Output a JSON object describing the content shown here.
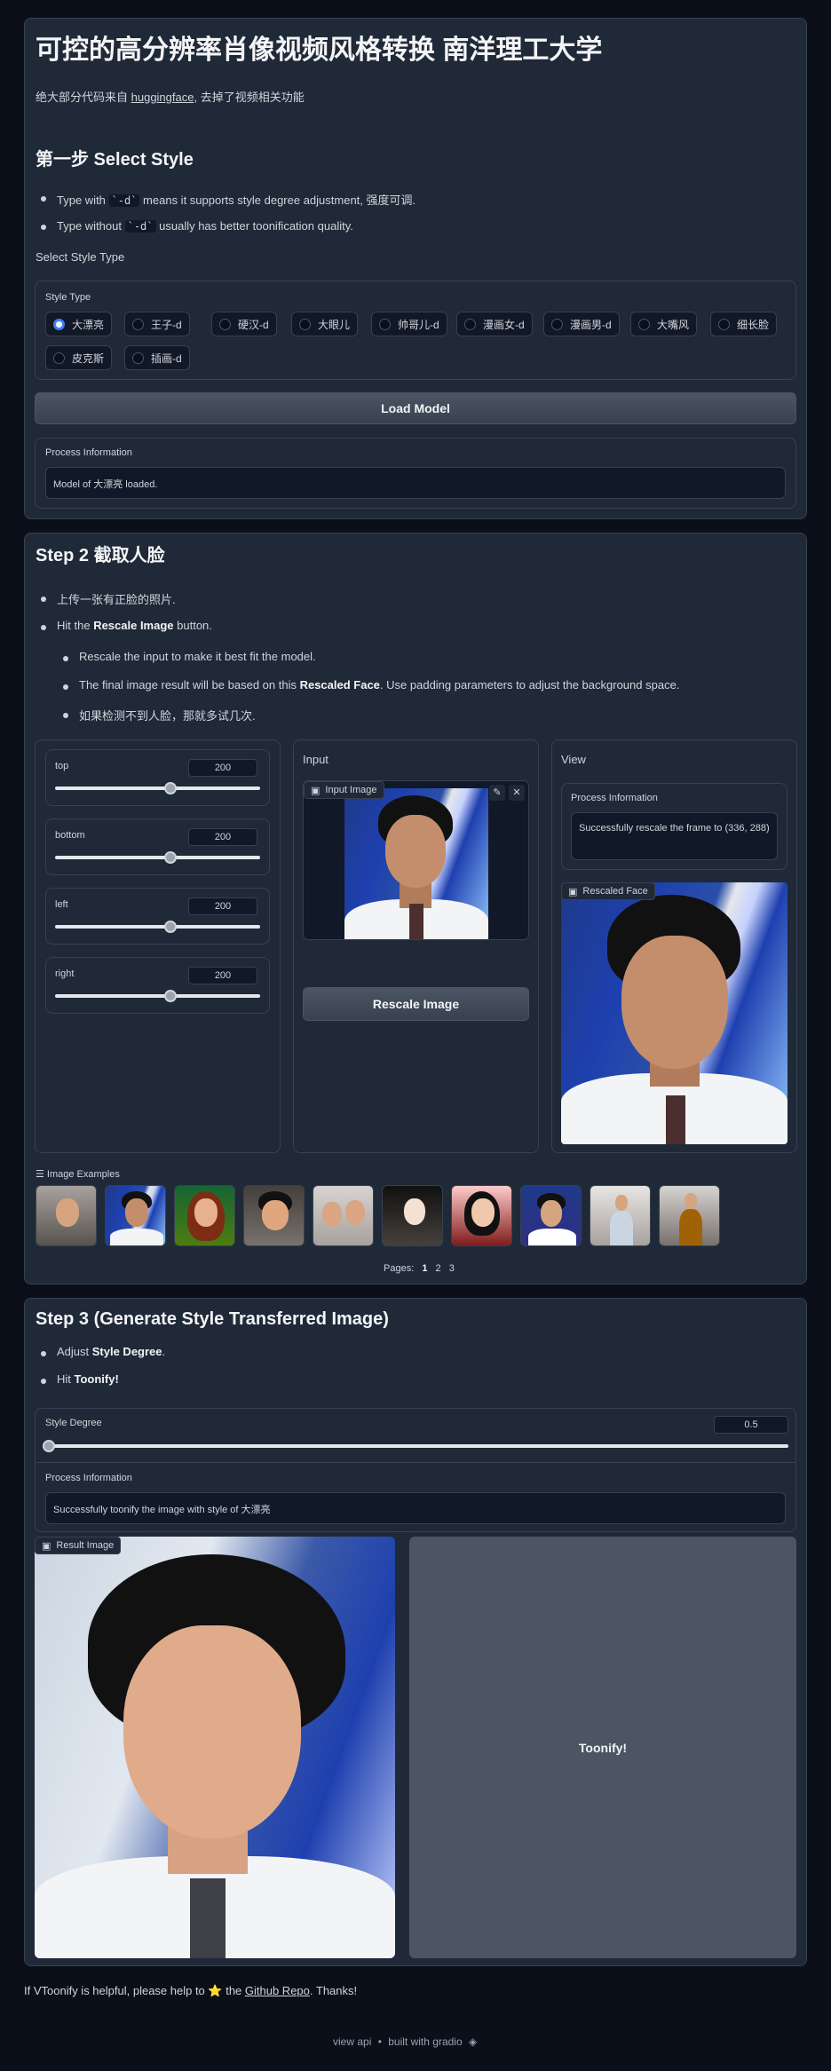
{
  "header": {
    "title": "可控的高分辨率肖像视频风格转换 南洋理工大学",
    "subtitle_prefix": "绝大部分代码来自 ",
    "subtitle_link": "huggingface",
    "subtitle_suffix": ", 去掉了视频相关功能"
  },
  "step1": {
    "heading": "第一步 Select Style",
    "bullet1_pre": "Type with ",
    "bullet1_code": "`-d`",
    "bullet1_post": " means it supports style degree adjustment, 强度可调.",
    "bullet2_pre": "Type without ",
    "bullet2_code": "`-d`",
    "bullet2_post": " usually has better toonification quality.",
    "select_label": "Select Style Type",
    "style_type_label": "Style Type",
    "options": [
      "大漂亮",
      "王子-d",
      "硬汉-d",
      "大眼儿",
      "帅哥儿-d",
      "漫画女-d",
      "漫画男-d",
      "大嘴风",
      "细长脸",
      "皮克斯",
      "插画-d"
    ],
    "selected": "大漂亮",
    "load_button": "Load Model",
    "process_label": "Process Information",
    "process_text": "Model of 大漂亮 loaded."
  },
  "step2": {
    "heading": "Step 2 截取人脸",
    "bullet1": "上传一张有正脸的照片.",
    "bullet2_pre": "Hit the ",
    "bullet2_bold": "Rescale Image",
    "bullet2_post": " button.",
    "sub1": "Rescale the input to make it best fit the model.",
    "sub2_pre": "The final image result will be based on this ",
    "sub2_bold": "Rescaled Face",
    "sub2_post": ". Use padding parameters to adjust the background space.",
    "sub3": "如果检测不到人脸，那就多试几次.",
    "sliders": [
      {
        "label": "top",
        "value": "200"
      },
      {
        "label": "bottom",
        "value": "200"
      },
      {
        "label": "left",
        "value": "200"
      },
      {
        "label": "right",
        "value": "200"
      }
    ],
    "input_title": "Input",
    "input_image_label": "Input Image",
    "rescale_button": "Rescale Image",
    "view_title": "View",
    "view_process_label": "Process Information",
    "view_process_text": "Successfully rescale the frame to (336, 288)",
    "rescaled_label": "Rescaled Face",
    "examples_label": "Image Examples",
    "pages_label": "Pages:",
    "pages": [
      "1",
      "2",
      "3"
    ]
  },
  "step3": {
    "heading": "Step 3 (Generate Style Transferred Image)",
    "bullet1_pre": "Adjust ",
    "bullet1_bold": "Style Degree",
    "bullet1_post": ".",
    "bullet2_pre": "Hit ",
    "bullet2_bold": "Toonify!",
    "degree_label": "Style Degree",
    "degree_value": "0.5",
    "process_label": "Process Information",
    "process_text": "Successfully toonify the image with style of 大漂亮",
    "result_label": "Result Image",
    "toonify_button": "Toonify!"
  },
  "footer": {
    "note_pre": "If VToonify is helpful, please help to ",
    "note_star": "⭐",
    "note_mid": " the ",
    "note_link": "Github Repo",
    "note_post": ". Thanks!",
    "view_api": "view api",
    "dot": "•",
    "built_with": "built with gradio"
  }
}
